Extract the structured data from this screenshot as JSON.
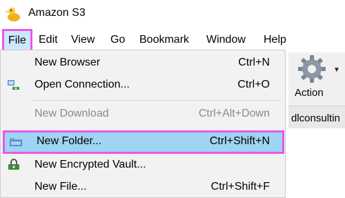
{
  "window": {
    "title": "Amazon S3"
  },
  "menubar": {
    "items": [
      {
        "label": "File"
      },
      {
        "label": "Edit"
      },
      {
        "label": "View"
      },
      {
        "label": "Go"
      },
      {
        "label": "Bookmark"
      },
      {
        "label": "Window"
      },
      {
        "label": "Help"
      }
    ]
  },
  "toolbar": {
    "action_label": "Action",
    "tab_text": "dlconsultin"
  },
  "file_menu": {
    "items": [
      {
        "label": "New Browser",
        "shortcut": "Ctrl+N"
      },
      {
        "label": "Open Connection...",
        "shortcut": "Ctrl+O",
        "icon": "connection-icon"
      },
      {
        "label": "New Download",
        "shortcut": "Ctrl+Alt+Down",
        "disabled": true
      },
      {
        "label": "New Folder...",
        "shortcut": "Ctrl+Shift+N",
        "icon": "folder-icon",
        "highlighted": true
      },
      {
        "label": "New Encrypted Vault...",
        "shortcut": "",
        "icon": "vault-icon"
      },
      {
        "label": "New File...",
        "shortcut": "Ctrl+Shift+F"
      }
    ]
  },
  "colors": {
    "highlight": "#9fd4f2",
    "annotation": "#e957e9",
    "menu_bg": "#f2f2f2",
    "disabled_text": "#8a8a8a"
  }
}
